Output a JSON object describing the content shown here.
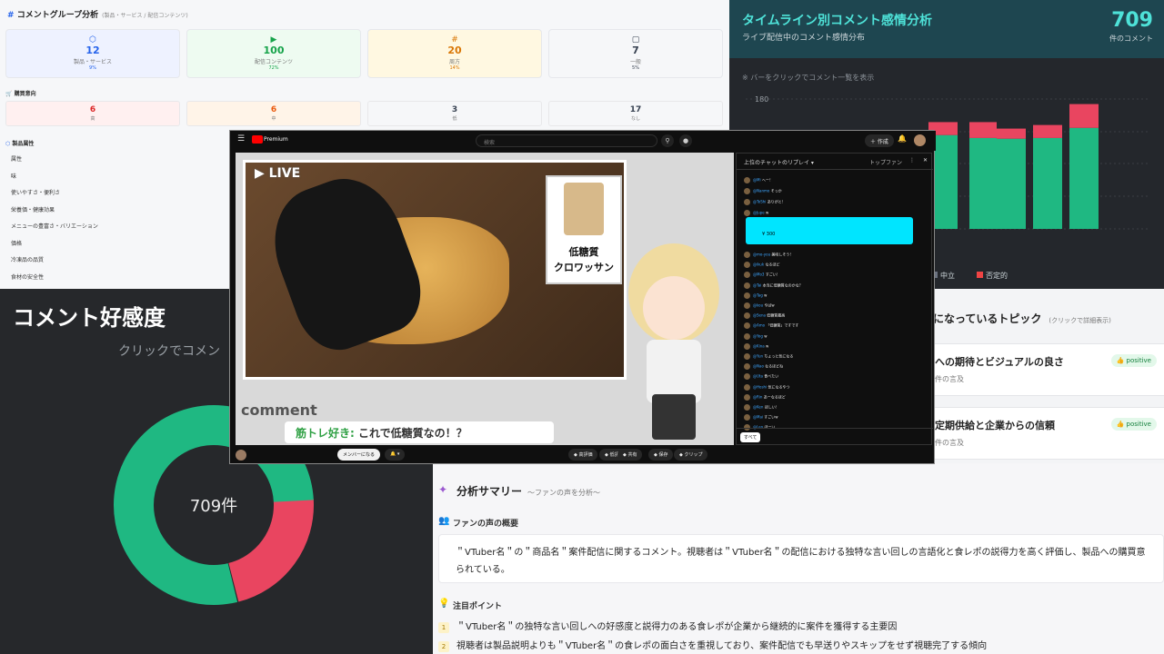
{
  "group_panel": {
    "title": "コメントグループ分析",
    "subtitle": "(製品・サービス / 配信コンテンツ)",
    "groups": [
      {
        "icon": "cube-icon",
        "value": "12",
        "label": "製品・サービス",
        "pct": "9%",
        "bg": "#eef2ff",
        "color": "#2563eb"
      },
      {
        "icon": "play-icon",
        "value": "100",
        "label": "配信コンテンツ",
        "pct": "72%",
        "bg": "#eefbf1",
        "color": "#16a34a"
      },
      {
        "icon": "hash-icon",
        "value": "20",
        "label": "周方",
        "pct": "14%",
        "bg": "#fff8e1",
        "color": "#d97706"
      },
      {
        "icon": "chat-icon",
        "value": "7",
        "label": "一般",
        "pct": "5%",
        "bg": "#f6f7f9",
        "color": "#374151"
      }
    ],
    "purchase_title": "購買意向",
    "purchase": [
      {
        "value": "6",
        "label": "高",
        "bg": "#fff0f0",
        "color": "#dc2626"
      },
      {
        "value": "6",
        "label": "中",
        "bg": "#fff4e8",
        "color": "#ea580c"
      },
      {
        "value": "3",
        "label": "低",
        "bg": "#f6f7f9",
        "color": "#374151"
      },
      {
        "value": "17",
        "label": "なし",
        "bg": "#f6f7f9",
        "color": "#374151"
      }
    ],
    "attr_title": "製品属性",
    "attributes": [
      "属性",
      "味",
      "使いやすさ・便利さ",
      "栄養価・健康効果",
      "メニューの豊富さ・バリエーション",
      "価格",
      "冷凍品の品質",
      "食材の安全性"
    ]
  },
  "timeline_panel": {
    "title": "タイムライン別コメント感情分析",
    "subtitle": "ライブ配信中のコメント感情分布",
    "total": "709",
    "total_label": "件のコメント",
    "hint": "※ バーをクリックでコメント一覧を表示",
    "legend": [
      {
        "label": "中立",
        "color": "#6b7280"
      },
      {
        "label": "否定的",
        "color": "#ef4444"
      }
    ]
  },
  "donut_panel": {
    "title": "コメント好感度",
    "subtitle": "クリックでコメン",
    "center": "709件"
  },
  "topics_panel": {
    "title": "になっているトピック",
    "hint": "(クリックで詳細表示)",
    "topics": [
      {
        "title": "への期待とビジュアルの良さ",
        "meta": "件の言及",
        "badge": "positive"
      },
      {
        "title": "定期供給と企業からの信頼",
        "meta": "件の言及",
        "badge": "positive"
      }
    ]
  },
  "summary_panel": {
    "title": "分析サマリー",
    "subtitle": "〜ファンの声を分析〜",
    "voice_title": "ファンの声の概要",
    "voice_text_1": "＂VTuber名＂の＂商品名＂案件配信に関するコメント。視聴者は＂VTuber名＂の配信における独特な言い回しの言語化と食レポの説得力を高く評価し、製品への購買意",
    "voice_text_2": "られている。",
    "points_title": "注目ポイント",
    "points": [
      {
        "n": "1",
        "text": "＂VTuber名＂の独特な言い回しへの好感度と説得力のある食レポが企業から継続的に案件を獲得する主要因"
      },
      {
        "n": "2",
        "text": "視聴者は製品説明よりも＂VTuber名＂の食レポの面白さを重視しており、案件配信でも早送りやスキップをせず視聴完了する傾向"
      }
    ]
  },
  "video": {
    "brand": "Premium",
    "search_placeholder": "検索",
    "create_label": "作成",
    "live_label": "LIVE",
    "product_label_1": "低糖質",
    "product_label_2": "クロワッサン",
    "comment_label": "comment",
    "comment_user": "筋トレ好き:",
    "comment_text": "これで低糖質なの！？",
    "chat_title": "上位のチャットのリプレイ",
    "chat_badge": "トップファン",
    "superchat_amount": "¥ 300",
    "chat_messages": [
      {
        "name": "@Mi",
        "text": "へー！"
      },
      {
        "name": "@Nanmo",
        "text": "そっか"
      },
      {
        "name": "@ToShi",
        "text": "ありがと！"
      },
      {
        "name": "@Jupe",
        "text": "w"
      },
      {
        "name": "@mo-you",
        "text": "美味しそう！"
      },
      {
        "name": "@ikuk",
        "text": "なるほど"
      },
      {
        "name": "@Mo3",
        "text": "すごい！"
      },
      {
        "name": "@Tai",
        "text": "本当に低糖質なのかな？"
      },
      {
        "name": "@Tag",
        "text": "w"
      },
      {
        "name": "@kou",
        "text": "やばw"
      },
      {
        "name": "@Sena",
        "text": "低糖質最高"
      },
      {
        "name": "@Amo",
        "text": "「低糖質」ですです"
      },
      {
        "name": "@Yog",
        "text": "w"
      },
      {
        "name": "@Kina",
        "text": "w"
      },
      {
        "name": "@Yun",
        "text": "ちょっと気になる"
      },
      {
        "name": "@Nao",
        "text": "なるほどね"
      },
      {
        "name": "@Uta",
        "text": "食べたい"
      },
      {
        "name": "@Hoshi",
        "text": "気になるやつ"
      },
      {
        "name": "@Rin",
        "text": "あーなるほど"
      },
      {
        "name": "@Ken",
        "text": "ほしい！"
      },
      {
        "name": "@Mai",
        "text": "すごいw"
      },
      {
        "name": "@Leo",
        "text": "ほーい"
      }
    ],
    "chat_filter": "すべて",
    "member_label": "メンバーになる",
    "actions": [
      "高評価",
      "低評価",
      "共有",
      "保存",
      "クリップ"
    ]
  },
  "colors": {
    "positive": "#1fb882",
    "negative": "#e94560",
    "accent": "#4ee2d8"
  },
  "chart_data": [
    {
      "type": "bar",
      "title": "タイムライン別コメント感情分析",
      "ylim": [
        0,
        180
      ],
      "ytick": "180",
      "series": [
        {
          "name": "中立",
          "values": [
            0,
            130,
            126,
            125,
            126,
            140
          ]
        },
        {
          "name": "否定的",
          "values": [
            0,
            18,
            22,
            14,
            18,
            33
          ]
        }
      ],
      "legend": "bottom-left"
    },
    {
      "type": "pie",
      "title": "コメント好感度",
      "total": 709,
      "slices": [
        {
          "color": "#1fb882",
          "value": 78
        },
        {
          "color": "#e94560",
          "value": 22
        }
      ]
    }
  ]
}
